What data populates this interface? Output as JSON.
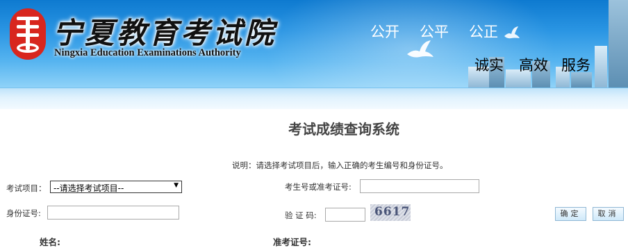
{
  "header": {
    "logo_cn": "宁夏教育考试院",
    "logo_en": "Ningxia Education Examinations Authority",
    "slogan_top": [
      "公开",
      "公平",
      "公正"
    ],
    "slogan_bottom": [
      "诚实",
      "高效",
      "服务"
    ]
  },
  "page_title": "考试成绩查询系统",
  "instruction": "说明：请选择考试项目后，输入正确的考生编号和身份证号。",
  "form": {
    "exam_label": "考试项目：",
    "exam_selected": "--请选择考试项目--",
    "candidate_label": "考生号或准考证号:",
    "candidate_value": "",
    "id_label": "身份证号:",
    "id_value": "",
    "captcha_label": "验 证 码:",
    "captcha_value": "",
    "captcha_text": "6617",
    "confirm_label": "确定",
    "cancel_label": "取消"
  },
  "results": {
    "name_label": "姓名:",
    "ticket_label": "准考证号:"
  },
  "colors": {
    "banner_top": "#0e7ad0",
    "banner_bottom": "#8fd2f8",
    "seal_red": "#d8261e",
    "button_border": "#8fb7d4"
  }
}
